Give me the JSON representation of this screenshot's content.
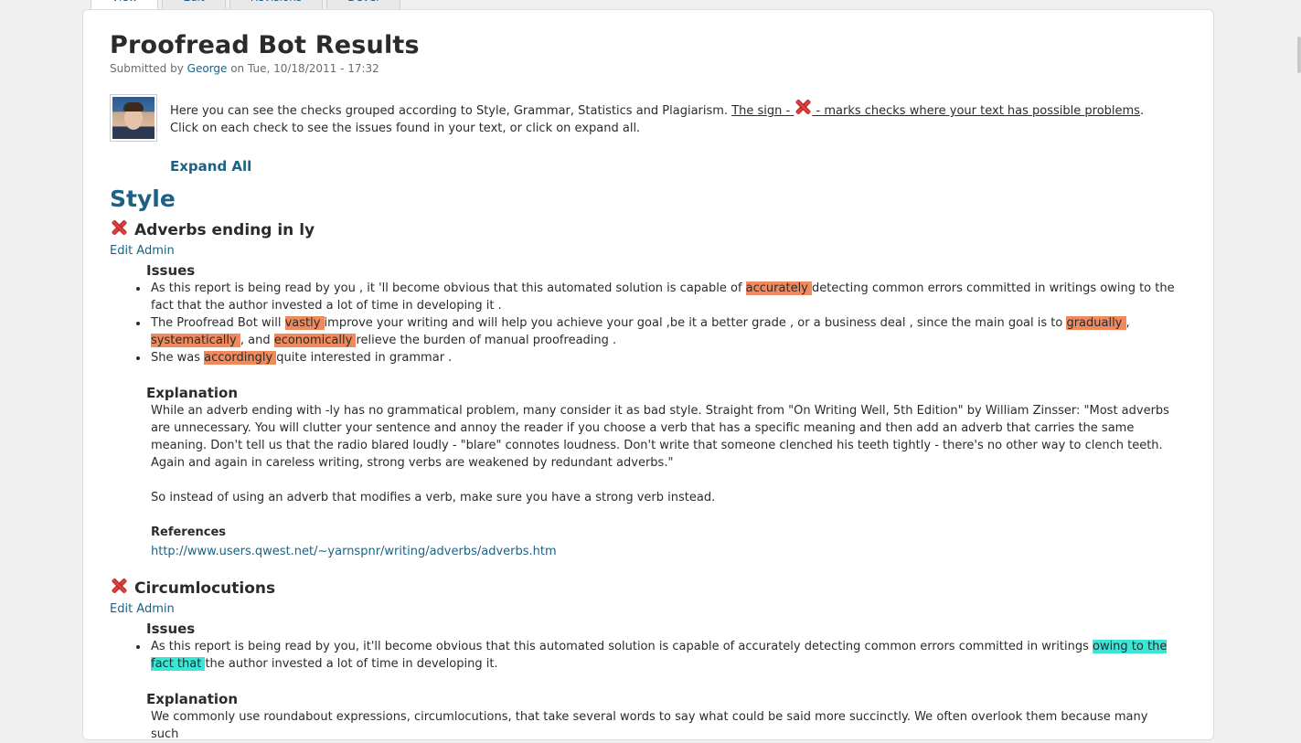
{
  "tabs": [
    "View",
    "Edit",
    "Revisions",
    "Devel"
  ],
  "page": {
    "title": "Proofread Bot Results",
    "submitted_prefix": "Submitted by",
    "author": "George",
    "submitted_suffix": "on Tue, 10/18/2011 - 17:32"
  },
  "intro": {
    "text_before": "Here you can see the checks grouped according to Style, Grammar, Statistics and Plagiarism.",
    "sign_before": "The sign -",
    "sign_after": "- marks checks where your text has possible problems",
    "text_after": ". Click on each check to see the issues found in your text, or click on expand all.",
    "expand_all": "Expand All"
  },
  "section": {
    "title": "Style"
  },
  "checks": [
    {
      "title": "Adverbs ending in ly",
      "edit_admin": "Edit Admin",
      "issues_heading": "Issues",
      "explanation_heading": "Explanation",
      "explanation_1": "While an adverb ending with -ly has no grammatical problem, many consider it as bad style. Straight from \"On Writing Well, 5th Edition\" by William Zinsser: \"Most adverbs are unnecessary. You will clutter your sentence and annoy the reader if you choose a verb that has a specific meaning and then add an adverb that carries the same meaning. Don't tell us that the radio blared loudly - \"blare\" connotes loudness. Don't write that someone clenched his teeth tightly - there's no other way to clench teeth. Again and again in careless writing, strong verbs are weakened by redundant adverbs.\"",
      "explanation_2": "So instead of using an adverb that modifies a verb, make sure you have a strong verb instead.",
      "references_heading": "References",
      "reference_link": "http://www.users.qwest.net/~yarnspnr/writing/adverbs/adverbs.htm",
      "issue_1": {
        "a": "As this report is being read by you , it 'll become obvious that this automated solution is capable of ",
        "h1": "accurately ",
        "b": "detecting common errors committed in writings owing to the fact that the author invested a lot of time in developing it ."
      },
      "issue_2": {
        "a": "The Proofread Bot will ",
        "h1": "vastly ",
        "b": "improve your writing and will help you achieve your goal ,be it a better grade , or a business deal , since the main goal is to ",
        "h2": "gradually ",
        "c": ", ",
        "h3": "systematically ",
        "d": ", and ",
        "h4": "economically ",
        "e": "relieve the burden of manual proofreading ."
      },
      "issue_3": {
        "a": "She was ",
        "h1": "accordingly ",
        "b": "quite interested in grammar ."
      }
    },
    {
      "title": "Circumlocutions",
      "edit_admin": "Edit Admin",
      "issues_heading": "Issues",
      "explanation_heading": "Explanation",
      "explanation_1": "We commonly use roundabout expressions, circumlocutions, that take several words to say what could be said more succinctly. We often overlook them because many such",
      "issue_1": {
        "a": "As this report is being read by you, it'll become obvious that this automated solution is capable of accurately detecting common errors committed in writings ",
        "h1": "owing to the fact that ",
        "b": "the author invested a lot of time in developing it."
      }
    }
  ],
  "colors": {
    "link": "#1d6285",
    "highlight_style": "#f08a5d",
    "highlight_circumlocution": "#3ce6d6",
    "error_icon": "#d43030"
  }
}
